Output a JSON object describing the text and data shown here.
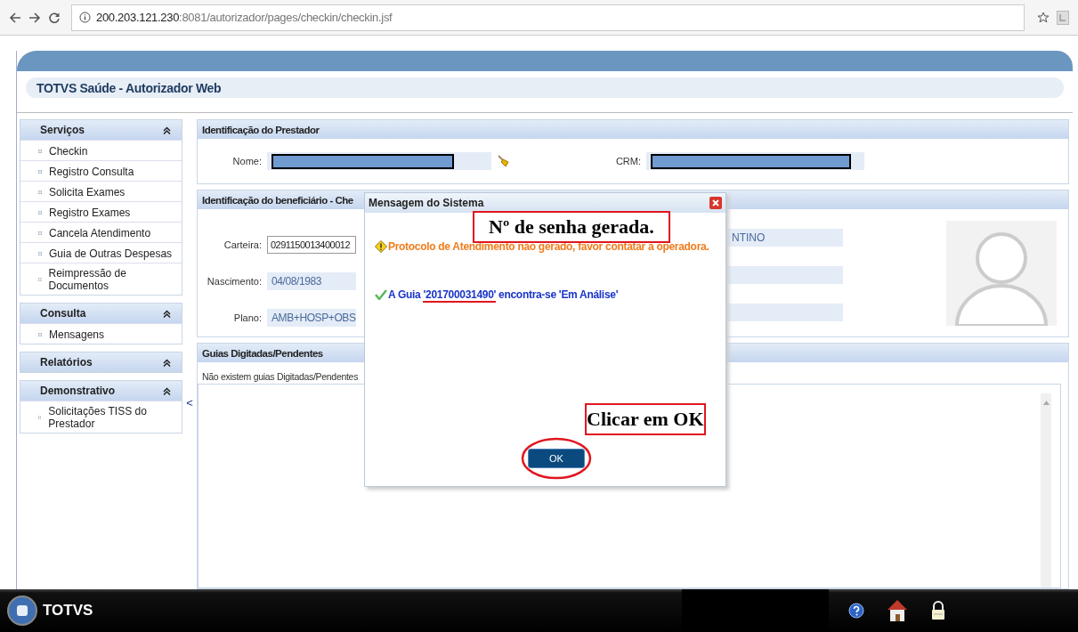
{
  "browser": {
    "url_host": "200.203.121.230",
    "url_rest": ":8081/autorizador/pages/checkin/checkin.jsf"
  },
  "app_title": "TOTVS Saúde - Autorizador Web",
  "sidebar": [
    {
      "title": "Serviços",
      "items": [
        "Checkin",
        "Registro Consulta",
        "Solicita Exames",
        "Registro Exames",
        "Cancela Atendimento",
        "Guia de Outras Despesas",
        "Reimpressão de Documentos"
      ]
    },
    {
      "title": "Consulta",
      "items": [
        "Mensagens"
      ]
    },
    {
      "title": "Relatórios"
    },
    {
      "title": "Demonstrativo",
      "items": [
        "Solicitações TISS do Prestador"
      ]
    }
  ],
  "collapse_glyph": "<",
  "prestador": {
    "title": "Identificação do Prestador",
    "name_label": "Nome:",
    "crm_label": "CRM:"
  },
  "beneficiario": {
    "title": "Identificação do beneficiário - Che",
    "fields": [
      {
        "label": "Carteira:",
        "value": "0291150013400012",
        "kind": "input"
      },
      {
        "label": "Nascimento:",
        "value": "04/08/1983",
        "kind": "readonly"
      },
      {
        "label": "Plano:",
        "value": "AMB+HOSP+OBS",
        "kind": "readonly"
      }
    ],
    "side_value": "NTINO"
  },
  "guias": {
    "title": "Guias Digitadas/Pendentes",
    "message": "Não existem guias Digitadas/Pendentes"
  },
  "dialog": {
    "title": "Mensagem do Sistema",
    "messages": [
      {
        "kind": "warning",
        "parts": [
          "Protocolo de Atendimento não gerado, favor contatar a operadora."
        ]
      },
      {
        "kind": "success",
        "parts": [
          "A Guia ",
          "'201700031490'",
          " encontra-se 'Em Análise'"
        ]
      }
    ],
    "button": "OK"
  },
  "annotations": [
    {
      "text": "Nº de senha gerada."
    },
    {
      "text": "Clicar em OK"
    }
  ],
  "footer": {
    "brand": "TOTVS"
  }
}
